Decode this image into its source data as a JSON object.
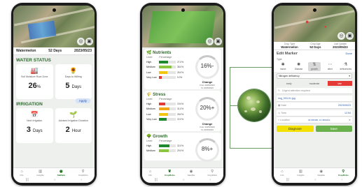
{
  "left_phone": {
    "field_name": "Watermelon",
    "days": "52 Days",
    "date": "2023/05/23",
    "water_status_title": "WATER STATUS",
    "cards": [
      {
        "label": "Soil Moisture Root Zone",
        "value": "26",
        "unit": "%"
      },
      {
        "label": "Days to Wilting",
        "value": "5",
        "unit": "Days"
      }
    ],
    "irrigation_title": "IRRIGATION",
    "apply_label": "Apply",
    "irrigation_cards": [
      {
        "label": "Next Irrigation",
        "value": "3",
        "unit": "Days"
      },
      {
        "label": "Advised Irrigation Duration",
        "value": "2",
        "unit": "Hour"
      }
    ],
    "nav": [
      "Info",
      "Insights",
      "SatData",
      "CropRobo"
    ]
  },
  "middle_phone": {
    "blocks": [
      {
        "title": "Nutrients",
        "col_level": "Level",
        "col_pct": "Percentage",
        "rows": [
          {
            "label": "High",
            "pct": "27.0%",
            "fill": 0.27,
            "color": "#1e8a2e"
          },
          {
            "label": "Medium",
            "pct": "38.0%",
            "fill": 0.38,
            "color": "#8cc63f"
          },
          {
            "label": "Low",
            "pct": "26.0%",
            "fill": 0.26,
            "color": "#f2c511"
          },
          {
            "label": "Very Low",
            "pct": "9.0%",
            "fill": 0.09,
            "color": "#e53935"
          }
        ],
        "change_value": "16%-",
        "change_label": "Change",
        "change_from": "From 16/05/2023",
        "change_to": "To 23/05/2023"
      },
      {
        "title": "Stress",
        "col_level": "Level",
        "col_pct": "Percentage",
        "rows": [
          {
            "label": "High",
            "pct": "19.0%",
            "fill": 0.19,
            "color": "#e53935"
          },
          {
            "label": "Medium",
            "pct": "31.0%",
            "fill": 0.31,
            "color": "#f2a611"
          },
          {
            "label": "Low",
            "pct": "28.0%",
            "fill": 0.28,
            "color": "#f2c511"
          },
          {
            "label": "Very Low",
            "pct": "22.0%",
            "fill": 0.22,
            "color": "#1e8a2e"
          }
        ],
        "change_value": "20%+",
        "change_label": "Change",
        "change_from": "From 16/05/2023",
        "change_to": "To 23/05/2023"
      },
      {
        "title": "Growth",
        "col_level": "Level",
        "col_pct": "Percentage",
        "rows": [
          {
            "label": "High",
            "pct": "32.0%",
            "fill": 0.32,
            "color": "#1e8a2e"
          },
          {
            "label": "Medium",
            "pct": "29.0%",
            "fill": 0.29,
            "color": "#8cc63f"
          }
        ],
        "change_value": "8%+",
        "change_label": "Change"
      }
    ],
    "nav": [
      "Info",
      "CropRobo",
      "Satellite",
      "CropRobo"
    ]
  },
  "right_phone": {
    "crop_type_label": "Crop Type",
    "crop_type": "Watermelon",
    "crop_age_label": "Crop Age",
    "crop_age": "52 Days",
    "last_update_label": "Last Update",
    "last_update": "2023/05/23",
    "edit_title": "Edit Marker",
    "done_label": "Done",
    "type_label": "Type",
    "types": [
      "insect",
      "Disease",
      "growth",
      "other",
      "deficiencies"
    ],
    "select_value": "Nitrogen deficiency",
    "severity": [
      "early",
      "moderate",
      "late"
    ],
    "notes_placeholder": "Urgent attention required",
    "image_name": "img_003-01.jpg",
    "date_label": "Date",
    "date_value": "2023/05/23",
    "time_label": "Time",
    "time_value": "12:54",
    "location_label": "Location",
    "location_value": "30.065486, 31.4566421",
    "diagnose_label": "Diagnose",
    "save_label": "Save",
    "nav": [
      "Info",
      "Insights",
      "Satellite",
      "CropRobo"
    ]
  }
}
